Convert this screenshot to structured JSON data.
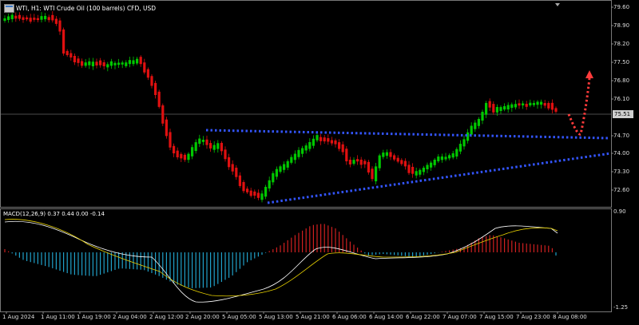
{
  "header": {
    "title": "WTI, H1:  WTI Crude Oil (100 barrels) CFD, USD",
    "icon": "chart-window-icon"
  },
  "price_axis": {
    "labels": [
      "79.60",
      "78.90",
      "78.20",
      "77.50",
      "76.80",
      "76.10",
      "74.70",
      "74.00",
      "73.30",
      "72.60"
    ],
    "current_price": "75.51"
  },
  "macd": {
    "title": "MACD(12,26,9) 0.37 0.44 0.00 -0.14",
    "axis_top": "0.90",
    "axis_bottom": "-1.25"
  },
  "time_axis": {
    "labels": [
      "1 Aug 2024",
      "1 Aug 11:00",
      "1 Aug 19:00",
      "2 Aug 04:00",
      "2 Aug 12:00",
      "2 Aug 20:00",
      "5 Aug 05:00",
      "5 Aug 13:00",
      "5 Aug 21:00",
      "6 Aug 06:00",
      "6 Aug 14:00",
      "6 Aug 22:00",
      "7 Aug 07:00",
      "7 Aug 15:00",
      "7 Aug 23:00",
      "8 Aug 08:00"
    ]
  },
  "colors": {
    "bull": "#00c800",
    "bear": "#e01010",
    "trendline": "#3355ff",
    "arrow": "#ff3b3b",
    "macd_hist_pos": "#d02020",
    "macd_hist_neg": "#20a0c8",
    "macd_line": "#ffffff",
    "signal_line": "#e8d200",
    "grid": "#777777"
  }
}
